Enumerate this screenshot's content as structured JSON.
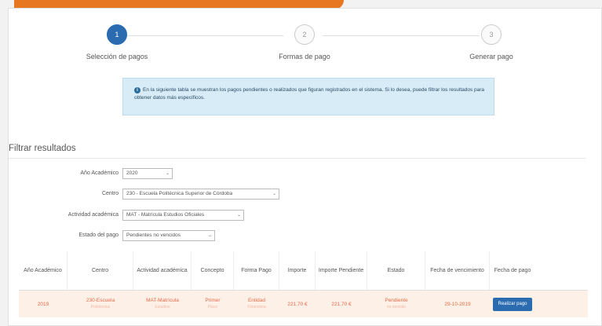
{
  "steps": [
    {
      "number": "1",
      "label": "Selección de pagos",
      "active": true
    },
    {
      "number": "2",
      "label": "Formas de pago",
      "active": false
    },
    {
      "number": "3",
      "label": "Generar pago",
      "active": false
    }
  ],
  "info": {
    "text": "En la siguiente tabla se muestran los pagos pendientes o realizados que figuran registrados en el sistema. Si lo desea, puede filtrar los resultados para obtener datos más específicos."
  },
  "filter": {
    "title": "Filtrar resultados",
    "fields": [
      {
        "label": "Año Académico",
        "value": "2020"
      },
      {
        "label": "Centro",
        "value": "230 - Escuela Politécnica Superior de Córdoba"
      },
      {
        "label": "Actividad académica",
        "value": "MAT - Matrícula Estudios Oficiales"
      },
      {
        "label": "Estado del pago",
        "value": "Pendientes no vencidos"
      }
    ]
  },
  "table": {
    "headers": [
      "Año Académico",
      "Centro",
      "Actividad académica",
      "Concepto",
      "Forma Pago",
      "Importe",
      "Importe Pendiente",
      "Estado",
      "Fecha de vencimiento",
      "Fecha de pago"
    ],
    "row": {
      "year": "2019",
      "centro": "230-Escuela",
      "centro_sub": "Politécnica",
      "actividad": "MAT-Matrícula",
      "actividad_sub": "Estudios",
      "concepto": "Primer",
      "concepto_sub": "Plazo",
      "forma": "Entidad",
      "forma_sub": "Financiera",
      "importe": "221,70 €",
      "pendiente": "221,70 €",
      "estado": "Pendiente",
      "estado_sub": "no vencido",
      "vencimiento": "29-10-2019",
      "pay_button": "Realizar pago"
    }
  },
  "colors": {
    "accent": "#e87722",
    "primary": "#2b6cb0",
    "row_text": "#e66b4a"
  }
}
